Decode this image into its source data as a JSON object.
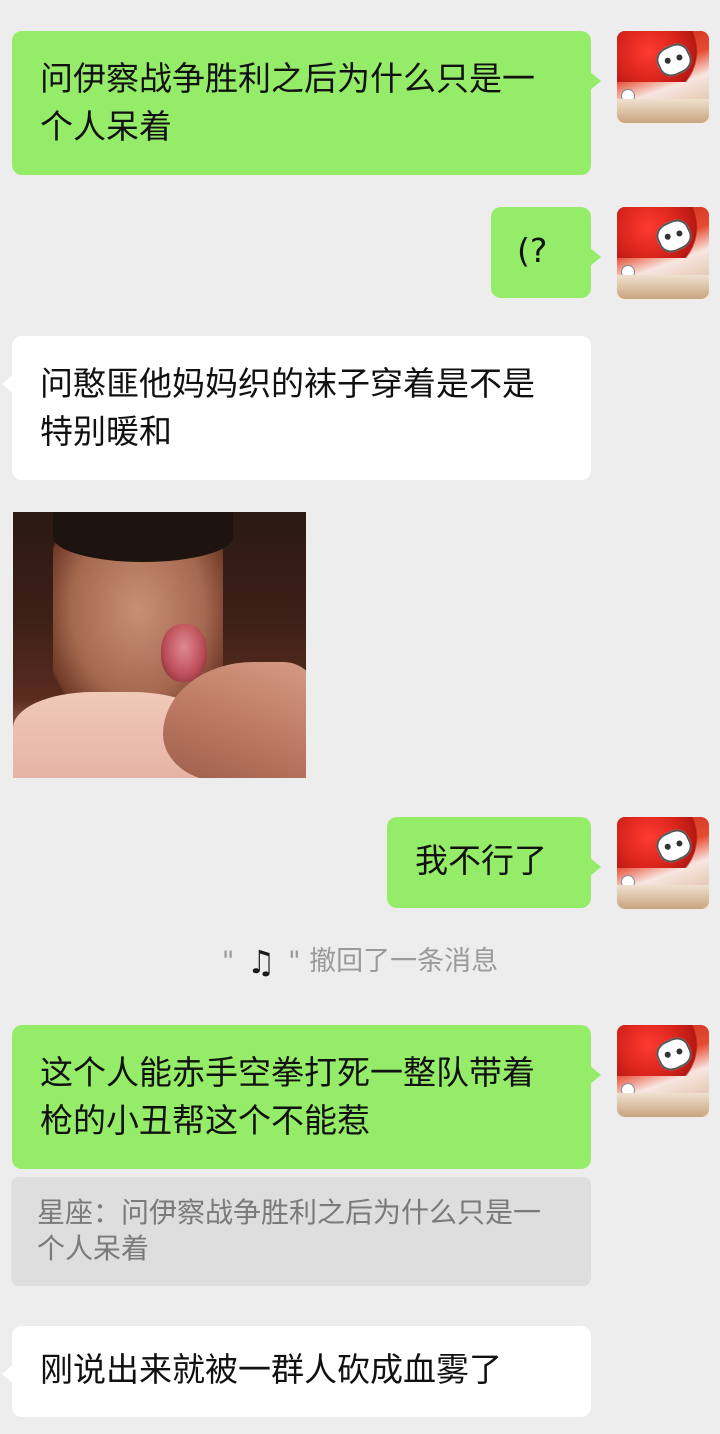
{
  "messages": {
    "m1": "问伊察战争胜利之后为什么只是一个人呆着",
    "m2": "(?",
    "m3": "问憨匪他妈妈织的袜子穿着是不是特别暖和",
    "m5": "我不行了",
    "m6": "这个人能赤手空拳打死一整队带着枪的小丑帮这个不能惹",
    "m7": "刚说出来就被一群人砍成血雾了"
  },
  "system": {
    "quote_open": "\"",
    "recalled_icon": "♫",
    "quote_close": "\"",
    "recall_text": "撤回了一条消息"
  },
  "quote": {
    "text": "星座：问伊察战争胜利之后为什么只是一个人呆着"
  },
  "colors": {
    "outgoing_bubble": "#95ec69",
    "incoming_bubble": "#ffffff",
    "background": "#ededed",
    "system_text": "#9a9a9a",
    "quote_bg": "#dedede"
  },
  "icons": {
    "recalled_message_icon": "music-note-icon"
  }
}
